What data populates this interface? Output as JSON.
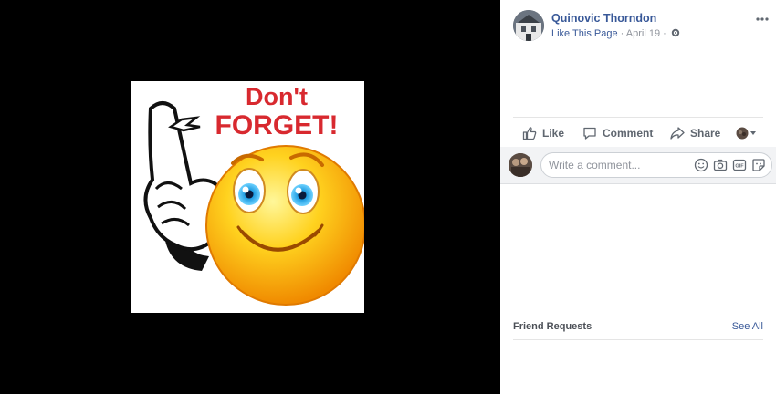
{
  "post": {
    "page_name": "Quinovic Thorndon",
    "like_page": "Like This Page",
    "separator": "·",
    "date": "April 19",
    "dot": "·"
  },
  "photo": {
    "text_line1": "Don't",
    "text_line2": "FORGET!",
    "text_color": "#d8292f"
  },
  "actions": {
    "like": "Like",
    "comment": "Comment",
    "share": "Share"
  },
  "comment": {
    "placeholder": "Write a comment..."
  },
  "friend_requests": {
    "title": "Friend Requests",
    "see_all": "See All"
  },
  "colors": {
    "link": "#385898",
    "muted": "#90949c",
    "action_text": "#606770",
    "viewer_bg": "#000000"
  },
  "icons": [
    "gear-icon",
    "more-icon",
    "like-icon",
    "comment-icon",
    "share-icon",
    "emoji-icon",
    "camera-icon",
    "gif-icon",
    "sticker-icon",
    "dropdown-caret-icon"
  ]
}
